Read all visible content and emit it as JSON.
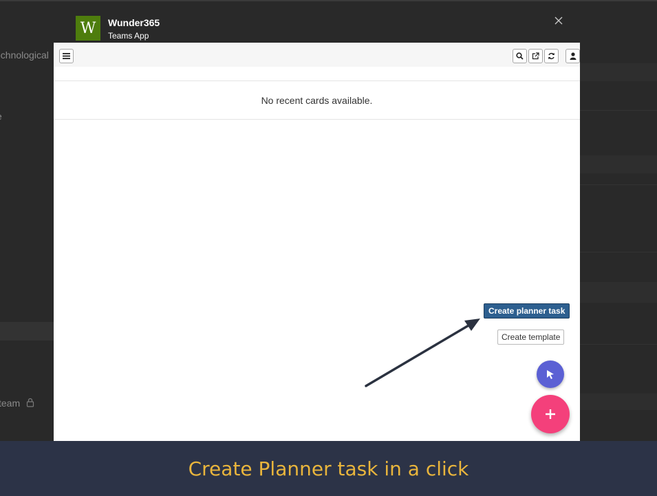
{
  "background": {
    "left_items": [
      "echnological",
      "e",
      "team"
    ]
  },
  "modal": {
    "logo_letter": "W",
    "app_name": "Wunder365",
    "app_subtitle": "Teams App",
    "empty_message": "No recent cards available.",
    "create_planner_task_label": "Create planner task",
    "create_template_label": "Create template",
    "icons": {
      "close": "close-icon",
      "menu": "hamburger-menu-icon",
      "search": "search-icon",
      "external": "external-link-icon",
      "refresh": "refresh-icon",
      "user": "user-icon",
      "small_fab": "rocket-icon",
      "large_fab": "plus-icon"
    }
  },
  "banner": {
    "caption": "Create Planner task in a click"
  },
  "colors": {
    "logo_green": "#4e7d0d",
    "primary_button": "#2d5f8f",
    "small_fab": "#5b60d4",
    "large_fab": "#f4407b",
    "banner_bg": "#2c3347",
    "banner_text": "#e9b53c"
  }
}
